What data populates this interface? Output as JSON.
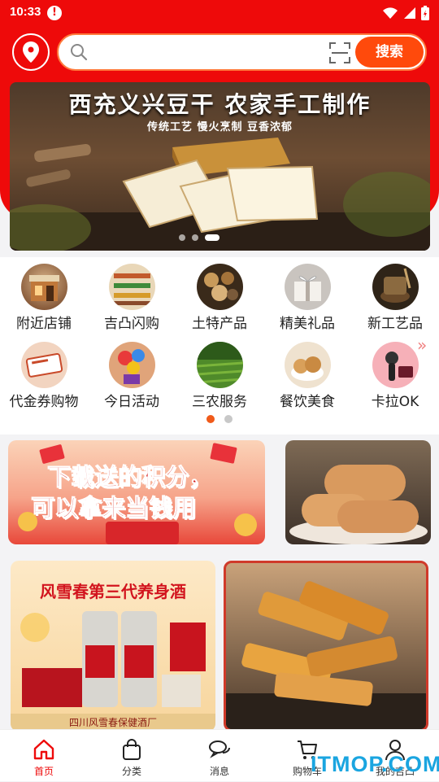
{
  "status_bar": {
    "time": "10:33"
  },
  "search": {
    "placeholder": "",
    "button_label": "搜索"
  },
  "banner": {
    "title": "西充义兴豆干  农家手工制作",
    "subtitle": "传统工艺  慢火烹制  豆香浓郁",
    "slide_count": 3,
    "active_slide": 3
  },
  "categories": [
    {
      "label": "附近店铺",
      "icon": "shop-icon"
    },
    {
      "label": "吉凸闪购",
      "icon": "supermarket-icon"
    },
    {
      "label": "土特产品",
      "icon": "local-produce-icon"
    },
    {
      "label": "精美礼品",
      "icon": "gift-icon"
    },
    {
      "label": "新工艺品",
      "icon": "craft-icon"
    },
    {
      "label": "代金券购物",
      "icon": "voucher-icon"
    },
    {
      "label": "今日活动",
      "icon": "balloons-icon"
    },
    {
      "label": "三农服务",
      "icon": "farm-field-icon"
    },
    {
      "label": "餐饮美食",
      "icon": "food-icon"
    },
    {
      "label": "卡拉OK",
      "icon": "microphone-icon"
    }
  ],
  "category_pages": {
    "count": 2,
    "active": 1
  },
  "promo_banner": {
    "line1": "下载送的积分，",
    "line2": "可以拿来当钱用"
  },
  "product_cards": [
    {
      "title": "风雪春第三代养身酒",
      "footer": "四川风雪春保健酒厂"
    },
    {
      "title": "",
      "footer": ""
    }
  ],
  "tab_bar": [
    {
      "label": "首页",
      "icon": "home-icon",
      "active": true
    },
    {
      "label": "分类",
      "icon": "bag-icon",
      "active": false
    },
    {
      "label": "消息",
      "icon": "chat-icon",
      "active": false
    },
    {
      "label": "购物车",
      "icon": "cart-icon",
      "active": false
    },
    {
      "label": "我的吉凸",
      "icon": "user-icon",
      "active": false
    }
  ],
  "watermark": "ITMOP.COM",
  "colors": {
    "brand_red": "#ee0a0a",
    "search_button": "#ff4a0c",
    "dot_active": "#f05a1a"
  }
}
